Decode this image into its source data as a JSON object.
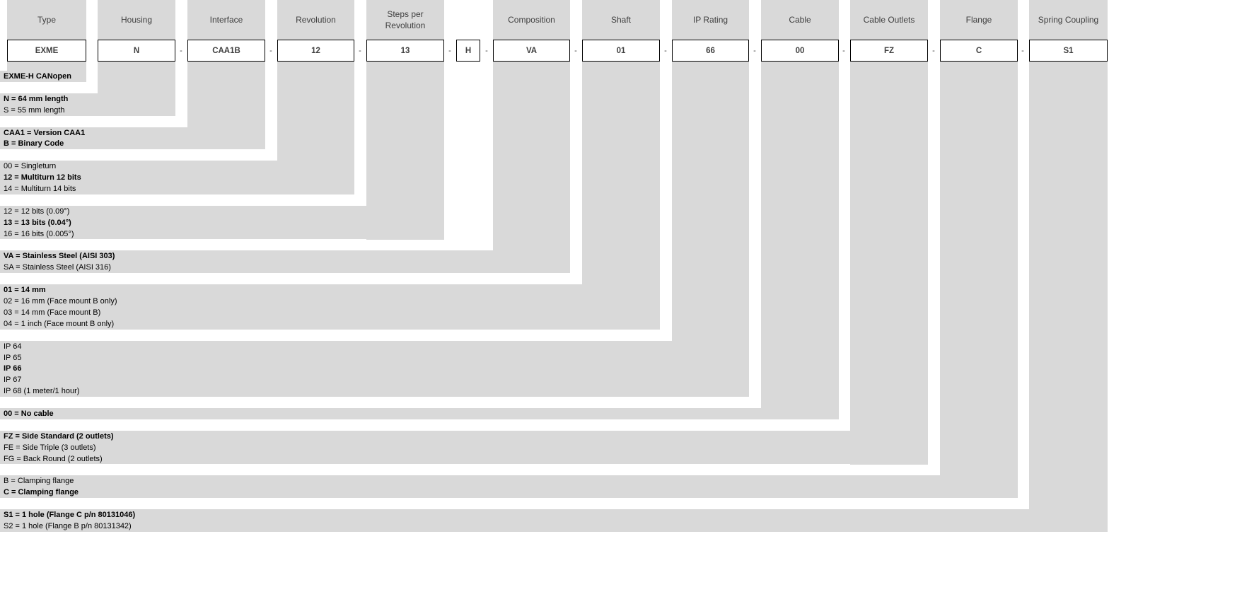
{
  "colors": {
    "background": "#ffffff",
    "panel": "#d9d9d9",
    "box_border": "#000000"
  },
  "columns": [
    {
      "header": "Type",
      "value": "EXME",
      "options": [
        {
          "text": "EXME-H CANopen",
          "selected": true
        }
      ]
    },
    {
      "header": "Housing",
      "value": "N",
      "options": [
        {
          "text": "N = 64 mm length",
          "selected": true
        },
        {
          "text": "S = 55 mm length",
          "selected": false
        }
      ]
    },
    {
      "header": "Interface",
      "value": "CAA1B",
      "options": [
        {
          "text": "CAA1 = Version CAA1",
          "selected": true
        },
        {
          "text": "B = Binary Code",
          "selected": true
        }
      ]
    },
    {
      "header": "Revolution",
      "value": "12",
      "options": [
        {
          "text": "00 = Singleturn",
          "selected": false
        },
        {
          "text": "12 = Multiturn 12 bits",
          "selected": true
        },
        {
          "text": "14 = Multiturn 14 bits",
          "selected": false
        }
      ]
    },
    {
      "header": "Steps per Revolution",
      "value": "13",
      "options": [
        {
          "text": "12 = 12 bits (0.09°)",
          "selected": false
        },
        {
          "text": "13 = 13 bits (0.04°)",
          "selected": true
        },
        {
          "text": "16 = 16 bits (0.005°)",
          "selected": false
        }
      ]
    },
    {
      "header": "",
      "value": "H",
      "options": []
    },
    {
      "header": "Composition",
      "value": "VA",
      "options": [
        {
          "text": "VA = Stainless Steel (AISI 303)",
          "selected": true
        },
        {
          "text": "SA = Stainless Steel (AISI 316)",
          "selected": false
        }
      ]
    },
    {
      "header": "Shaft",
      "value": "01",
      "options": [
        {
          "text": "01 = 14 mm",
          "selected": true
        },
        {
          "text": "02 = 16 mm (Face mount B only)",
          "selected": false
        },
        {
          "text": "03 = 14 mm (Face mount B)",
          "selected": false
        },
        {
          "text": "04 = 1 inch (Face mount B only)",
          "selected": false
        }
      ]
    },
    {
      "header": "IP Rating",
      "value": "66",
      "options": [
        {
          "text": "IP 64",
          "selected": false
        },
        {
          "text": "IP 65",
          "selected": false
        },
        {
          "text": "IP 66",
          "selected": true
        },
        {
          "text": "IP 67",
          "selected": false
        },
        {
          "text": "IP 68 (1 meter/1 hour)",
          "selected": false
        }
      ]
    },
    {
      "header": "Cable",
      "value": "00",
      "options": [
        {
          "text": "00 = No cable",
          "selected": true
        }
      ]
    },
    {
      "header": "Cable Outlets",
      "value": "FZ",
      "options": [
        {
          "text": "FZ = Side Standard (2 outlets)",
          "selected": true
        },
        {
          "text": "FE = Side Triple (3 outlets)",
          "selected": false
        },
        {
          "text": "FG = Back Round (2 outlets)",
          "selected": false
        }
      ]
    },
    {
      "header": "Flange",
      "value": "C",
      "options": [
        {
          "text": "B = Clamping flange",
          "selected": false
        },
        {
          "text": "C = Clamping flange",
          "selected": true
        }
      ]
    },
    {
      "header": "Spring Coupling",
      "value": "S1",
      "options": [
        {
          "text": "S1 = 1 hole (Flange C p/n 80131046)",
          "selected": true
        },
        {
          "text": "S2 = 1 hole (Flange B p/n 80131342)",
          "selected": false
        }
      ]
    }
  ],
  "separator": "-"
}
